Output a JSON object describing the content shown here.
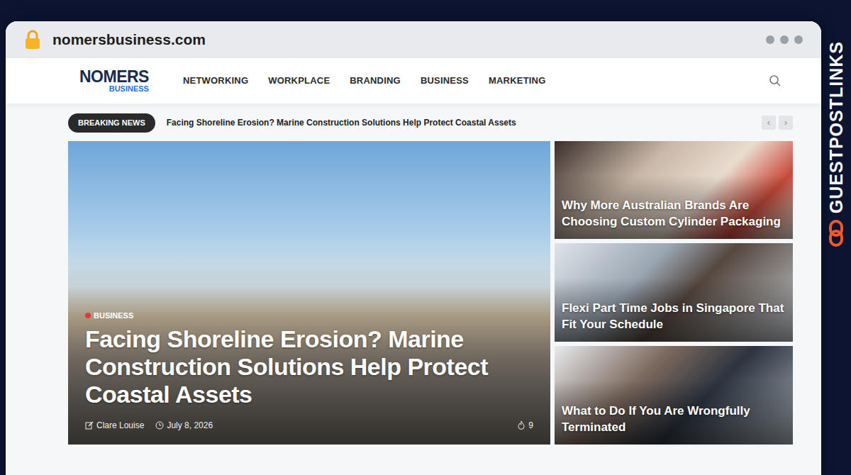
{
  "browser": {
    "url": "nomersbusiness.com"
  },
  "site": {
    "logo_top": "NOMERS",
    "logo_bottom": "BUSINESS"
  },
  "nav": [
    {
      "label": "NETWORKING"
    },
    {
      "label": "WORKPLACE"
    },
    {
      "label": "BRANDING"
    },
    {
      "label": "BUSINESS"
    },
    {
      "label": "MARKETING"
    }
  ],
  "breaking": {
    "label": "BREAKING NEWS",
    "headline": "Facing Shoreline Erosion? Marine Construction Solutions Help Protect Coastal Assets",
    "prev": "‹",
    "next": "›"
  },
  "featured": {
    "category": "BUSINESS",
    "title": "Facing Shoreline Erosion? Marine Construction Solutions Help Protect Coastal Assets",
    "author": "Clare Louise",
    "date": "July 8, 2026",
    "count": "9"
  },
  "side_posts": [
    {
      "title": "Why More Australian Brands Are Choosing Custom Cylinder Packaging"
    },
    {
      "title": "Flexi Part Time Jobs in Singapore That Fit Your Schedule"
    },
    {
      "title": "What to Do If You Are Wrongfully Terminated"
    }
  ],
  "brand": {
    "text": "GUESTPOSTLINKS"
  }
}
